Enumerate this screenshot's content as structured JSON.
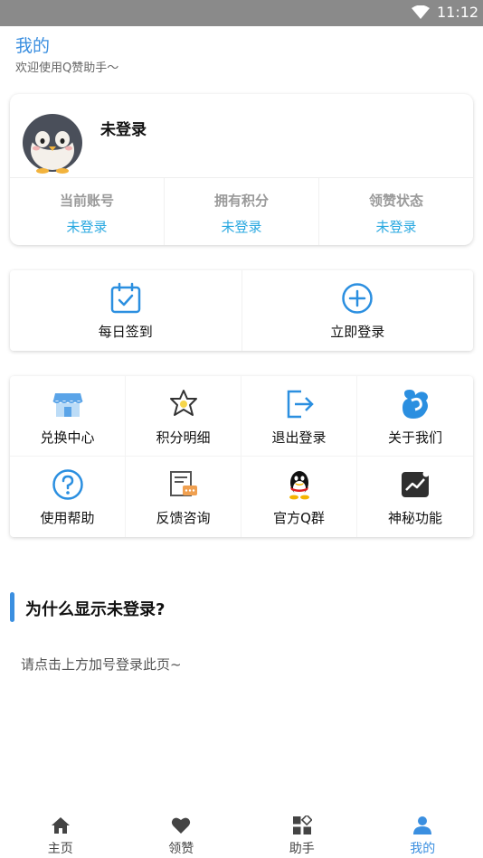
{
  "status_bar": {
    "time": "11:12"
  },
  "header": {
    "title": "我的",
    "subtitle": "欢迎使用Q赞助手～"
  },
  "profile": {
    "username": "未登录",
    "stats": [
      {
        "label": "当前账号",
        "value": "未登录"
      },
      {
        "label": "拥有积分",
        "value": "未登录"
      },
      {
        "label": "领赞状态",
        "value": "未登录"
      }
    ]
  },
  "actions": [
    {
      "label": "每日签到",
      "icon": "calendar-check-icon"
    },
    {
      "label": "立即登录",
      "icon": "plus-circle-icon"
    }
  ],
  "grid": [
    {
      "label": "兑换中心",
      "icon": "store-icon"
    },
    {
      "label": "积分明细",
      "icon": "star-badge-icon"
    },
    {
      "label": "退出登录",
      "icon": "logout-icon"
    },
    {
      "label": "关于我们",
      "icon": "app-logo-icon"
    },
    {
      "label": "使用帮助",
      "icon": "help-icon"
    },
    {
      "label": "反馈咨询",
      "icon": "feedback-icon"
    },
    {
      "label": "官方Q群",
      "icon": "qq-penguin-icon"
    },
    {
      "label": "神秘功能",
      "icon": "chart-icon"
    }
  ],
  "section": {
    "title": "为什么显示未登录?",
    "text": "请点击上方加号登录此页~"
  },
  "tabs": [
    {
      "label": "主页",
      "icon": "home-icon"
    },
    {
      "label": "领赞",
      "icon": "heart-icon"
    },
    {
      "label": "助手",
      "icon": "apps-icon"
    },
    {
      "label": "我的",
      "icon": "person-icon",
      "active": true
    }
  ],
  "colors": {
    "accent": "#3b8fe0",
    "stat_value": "#29a8e0",
    "status_bar": "#8a8a8a"
  }
}
